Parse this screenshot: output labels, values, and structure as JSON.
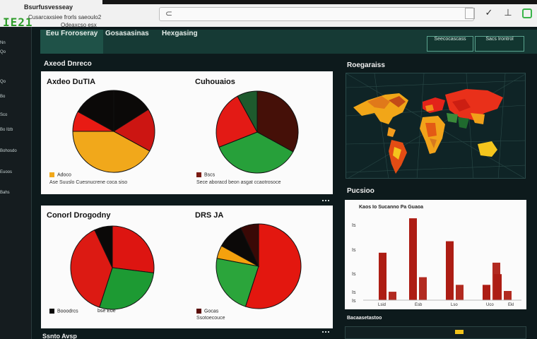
{
  "app": {
    "logo_text": "IE21",
    "brand": "Bsurfusvesseay",
    "subline_a": "Cusarcaxsiee frorls saeoulo2",
    "subline_b": "Odeaxcso esx"
  },
  "browser": {
    "address_glyph": "⊂",
    "icons": [
      "check-icon",
      "pin-icon",
      "shield-check-icon"
    ]
  },
  "sidebar": {
    "items": [
      "Nn",
      "Qo",
      "Qo",
      "Bo",
      "Sco",
      "Bo Ilzb",
      "Bohosdo",
      "Euoos",
      "Bahs"
    ]
  },
  "nav": {
    "tabs": [
      "Eeu Froroseray",
      "Gosasasinas",
      "Hexgasing"
    ],
    "active_tab": 0,
    "buttons": [
      "Seecocascass",
      "Sacs Irontrol"
    ]
  },
  "sections": {
    "left": "Axeod Dnreco",
    "map": "Roegaraiss",
    "bars": "Pucsioo",
    "bottom_left": "Ssnto Avsp",
    "bottom_right": "Bacaasetastoo"
  },
  "charts": [
    {
      "title": "Axdeo DuTIA",
      "legend": "Adoco",
      "note": "Ase Suuslo Cuesnucrene coca siso",
      "slices": [
        {
          "value": 16,
          "color": "#0b0908"
        },
        {
          "value": 17,
          "color": "#cc1512"
        },
        {
          "value": 42,
          "color": "#f1a81b"
        },
        {
          "value": 8,
          "color": "#e81b14"
        },
        {
          "value": 17,
          "color": "#0b0908"
        }
      ]
    },
    {
      "title": "Cuhouaios",
      "legend": "Bscs",
      "note": "Sece aboracd beon asgat ccaotrosoce",
      "slices": [
        {
          "value": 33,
          "color": "#451008"
        },
        {
          "value": 36,
          "color": "#27a03a"
        },
        {
          "value": 23,
          "color": "#e31a15"
        },
        {
          "value": 8,
          "color": "#1e5a2d"
        }
      ]
    },
    {
      "title": "Conorl Drogodny",
      "legend": "Booodrcs",
      "legend2": "bse Eoe",
      "slices": [
        {
          "value": 27,
          "color": "#dd1511"
        },
        {
          "value": 28,
          "color": "#1d9a33"
        },
        {
          "value": 38,
          "color": "#dc1a13"
        },
        {
          "value": 7,
          "color": "#0b0908"
        }
      ]
    },
    {
      "title": "DRS JA",
      "legend": "Gocas",
      "note": "Ssotoecouce",
      "slices": [
        {
          "value": 55,
          "color": "#e3170f"
        },
        {
          "value": 23,
          "color": "#2ba53b"
        },
        {
          "value": 5,
          "color": "#f4a10d"
        },
        {
          "value": 10,
          "color": "#0b0908"
        },
        {
          "value": 7,
          "color": "#3a0906"
        }
      ]
    }
  ],
  "bar_chart": {
    "header": "Kaos Io Sucanno Pa Guaoa",
    "ylabels": [
      "Is",
      "Is",
      "Is",
      "Is",
      "Is"
    ],
    "xlabels": [
      "Lsid",
      "Esb",
      "Lso",
      "Uco",
      "Ekl"
    ]
  },
  "chart_data": {
    "type": "bar",
    "categories": [
      "Lsid",
      "Esb",
      "Lso",
      "Uco",
      "Ekl"
    ],
    "series": [
      {
        "values": [
          6.2,
          10.7,
          7.7,
          2.0,
          3.4
        ]
      },
      {
        "values": [
          1.1,
          3.0,
          2.0,
          4.9,
          1.2
        ]
      }
    ],
    "colors": [
      "#ad1d14",
      "#b22a20"
    ],
    "ylim": [
      0,
      12
    ]
  },
  "colors": {
    "accent": "#163a35",
    "accent_active": "#1f5248",
    "logo": "#2e9c2a",
    "page": "#0d1a1c"
  }
}
